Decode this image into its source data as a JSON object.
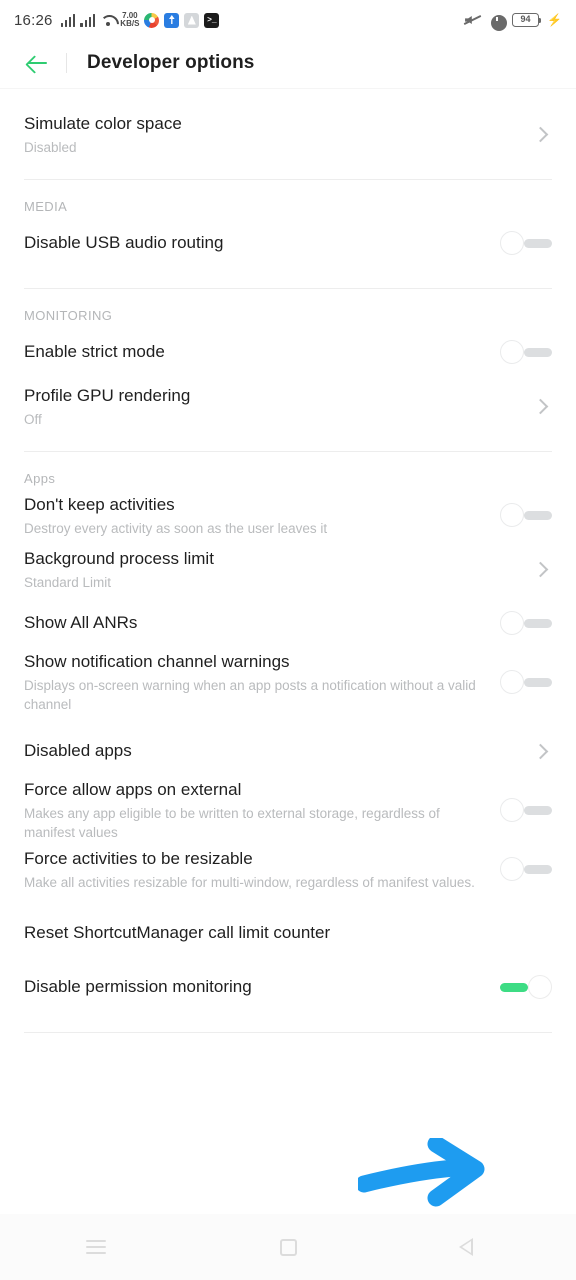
{
  "status_bar": {
    "clock": "16:26",
    "network_speed_value": "7.00",
    "network_speed_unit": "KB/S",
    "battery_level": "94",
    "icons": [
      "signal-bars-icon",
      "signal-bars-icon",
      "wifi-icon",
      "network-speed-icon",
      "photos-app-icon",
      "blue-app-icon",
      "gray-app-icon",
      "terminal-app-icon",
      "mute-icon",
      "alarm-icon",
      "battery-icon",
      "charging-bolt-icon"
    ]
  },
  "app_bar": {
    "title": "Developer options",
    "back_icon": "arrow-left-icon",
    "accent_color": "#2ecc71"
  },
  "annotation": {
    "type": "arrow",
    "direction": "right",
    "color": "#1e9cf0",
    "points_to": "Disable permission monitoring"
  },
  "nav_bar": {
    "recents_label": "recents-icon",
    "home_label": "home-icon",
    "back_label": "back-icon"
  },
  "sections": [
    {
      "label": null,
      "items": [
        {
          "title": "Simulate color space",
          "subtitle": "Disabled",
          "control": "chevron"
        }
      ]
    },
    {
      "label": "MEDIA",
      "items": [
        {
          "title": "Disable USB audio routing",
          "subtitle": null,
          "control": "toggle",
          "state": "off"
        }
      ]
    },
    {
      "label": "MONITORING",
      "items": [
        {
          "title": "Enable strict mode",
          "subtitle": null,
          "control": "toggle",
          "state": "off"
        },
        {
          "title": "Profile GPU rendering",
          "subtitle": "Off",
          "control": "chevron"
        }
      ]
    },
    {
      "label": "Apps",
      "items": [
        {
          "title": "Don't keep activities",
          "subtitle": "Destroy every activity as soon as the user leaves it",
          "control": "toggle",
          "state": "off"
        },
        {
          "title": "Background process limit",
          "subtitle": "Standard Limit",
          "control": "chevron"
        },
        {
          "title": "Show All ANRs",
          "subtitle": null,
          "control": "toggle",
          "state": "off"
        },
        {
          "title": "Show notification channel warnings",
          "subtitle": "Displays on-screen warning when an app posts a notification without a valid channel",
          "control": "toggle",
          "state": "off"
        },
        {
          "title": "Disabled apps",
          "subtitle": null,
          "control": "chevron"
        },
        {
          "title": "Force allow apps on external",
          "subtitle": "Makes any app eligible to be written to external storage, regardless of manifest values",
          "control": "toggle",
          "state": "off"
        },
        {
          "title": "Force activities to be resizable",
          "subtitle": "Make all activities resizable for multi-window, regardless of manifest values.",
          "control": "toggle",
          "state": "off"
        },
        {
          "title": "Reset ShortcutManager call limit counter",
          "subtitle": null,
          "control": "none"
        },
        {
          "title": "Disable permission monitoring",
          "subtitle": null,
          "control": "toggle",
          "state": "on"
        }
      ]
    }
  ]
}
